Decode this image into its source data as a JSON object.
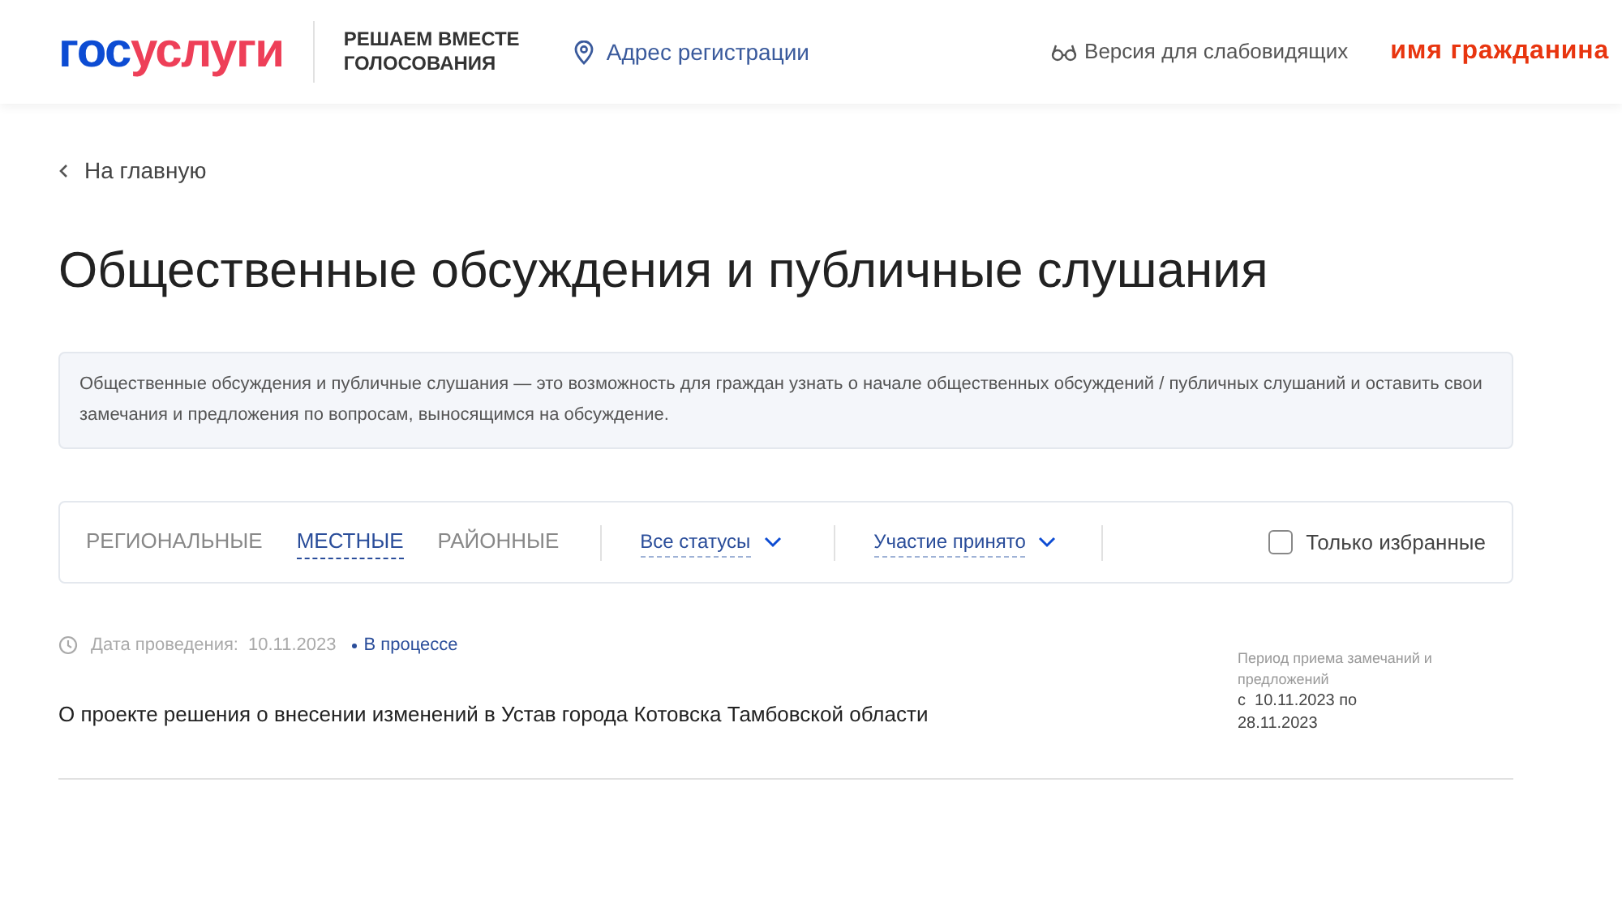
{
  "header": {
    "logo": {
      "first": "гос",
      "second": "услуги"
    },
    "tagline": "РЕШАЕМ ВМЕСТЕ ГОЛОСОВАНИЯ",
    "address_link": "Адрес регистрации",
    "accessibility_link": "Версия для слабовидящих",
    "user_name": "имя гражданина"
  },
  "back_link": "На главную",
  "title": "Общественные обсуждения и публичные слушания",
  "info": "Общественные обсуждения и публичные слушания — это возможность для граждан узнать о начале общественных обсуждений / публичных слушаний и оставить свои замечания и предложения по вопросам, выносящимся на обсуждение.",
  "filters": {
    "tabs": [
      {
        "label": "РЕГИОНАЛЬНЫЕ",
        "selected": false
      },
      {
        "label": "МЕСТНЫЕ",
        "selected": true
      },
      {
        "label": "РАЙОННЫЕ",
        "selected": false
      }
    ],
    "dropdowns": [
      "Все статусы",
      "Участие принято"
    ],
    "favorites": {
      "label": "Только избранные",
      "checked": false
    }
  },
  "items": [
    {
      "date_label": "Дата проведения:",
      "date": "10.11.2023",
      "status": "В процессе",
      "title": "О проекте решения о внесении изменений в Устав города Котовска Тамбовской области",
      "period_label": "Период приема замечаний и предложений",
      "period": "с  10.11.2023 по 28.11.2023"
    }
  ]
}
